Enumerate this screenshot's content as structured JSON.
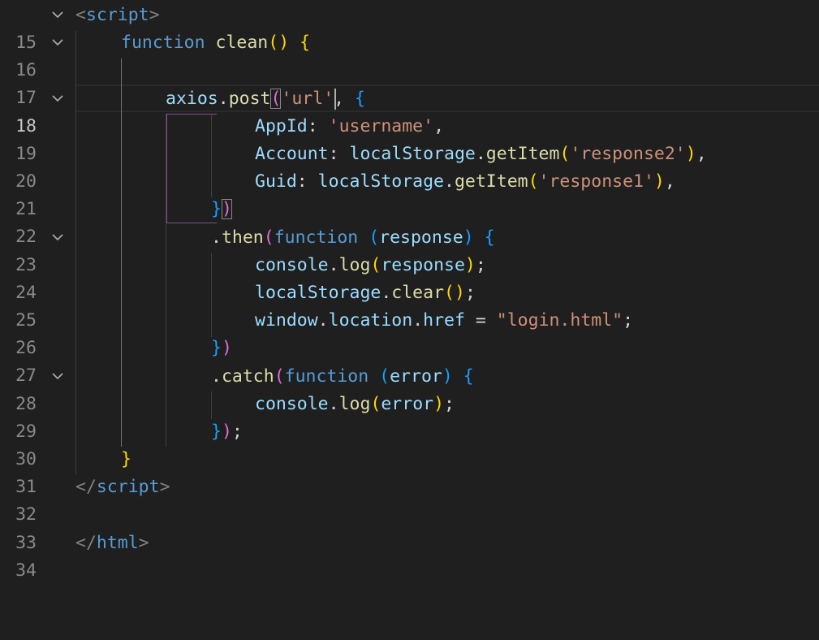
{
  "editor": {
    "lines": [
      {
        "num": "15",
        "fold": true
      },
      {
        "num": "16",
        "fold": true
      },
      {
        "num": "17",
        "fold": false
      },
      {
        "num": "18",
        "fold": true,
        "current": true
      },
      {
        "num": "19",
        "fold": false
      },
      {
        "num": "20",
        "fold": false
      },
      {
        "num": "21",
        "fold": false
      },
      {
        "num": "22",
        "fold": false
      },
      {
        "num": "23",
        "fold": true
      },
      {
        "num": "24",
        "fold": false
      },
      {
        "num": "25",
        "fold": false
      },
      {
        "num": "26",
        "fold": false
      },
      {
        "num": "27",
        "fold": false
      },
      {
        "num": "28",
        "fold": true
      },
      {
        "num": "29",
        "fold": false
      },
      {
        "num": "30",
        "fold": false
      },
      {
        "num": "31",
        "fold": false
      },
      {
        "num": "32",
        "fold": false
      },
      {
        "num": "33",
        "fold": false
      },
      {
        "num": "34",
        "fold": false
      }
    ],
    "tokens": {
      "l15": [
        "<",
        "script",
        ">"
      ],
      "l16": [
        "function",
        "clean",
        "(",
        ")",
        "{"
      ],
      "l18": [
        "axios",
        ".",
        "post",
        "(",
        "'url'",
        ", ",
        "{"
      ],
      "l19": [
        "AppId",
        ": ",
        "'username'",
        ","
      ],
      "l20": [
        "Account",
        ": ",
        "localStorage",
        ".",
        "getItem",
        "(",
        "'response2'",
        ")",
        ","
      ],
      "l21": [
        "Guid",
        ": ",
        "localStorage",
        ".",
        "getItem",
        "(",
        "'response1'",
        ")",
        ","
      ],
      "l22": [
        "}",
        ")"
      ],
      "l23": [
        ".",
        "then",
        "(",
        "function",
        " ",
        "(",
        "response",
        ")",
        " ",
        "{"
      ],
      "l24": [
        "console",
        ".",
        "log",
        "(",
        "response",
        ")",
        ";"
      ],
      "l25": [
        "localStorage",
        ".",
        "clear",
        "(",
        ")",
        ";"
      ],
      "l26": [
        "window",
        ".",
        "location",
        ".",
        "href",
        " = ",
        "\"login.html\"",
        ";"
      ],
      "l27": [
        "}",
        ")"
      ],
      "l28": [
        ".",
        "catch",
        "(",
        "function",
        " ",
        "(",
        "error",
        ")",
        " ",
        "{"
      ],
      "l29": [
        "console",
        ".",
        "log",
        "(",
        "error",
        ")",
        ";"
      ],
      "l30": [
        "}",
        ")",
        ";"
      ],
      "l31": [
        "}"
      ],
      "l32": [
        "</",
        "script",
        ">"
      ],
      "l34": [
        "</",
        "html",
        ">"
      ]
    }
  },
  "icons": {
    "fold": "chevron-down-icon"
  },
  "colors": {
    "background": "#1f1f1f",
    "keyword": "#569cd6",
    "function": "#dcdcaa",
    "variable": "#9cdcfe",
    "string": "#ce9178",
    "bracket_gold": "#ffd700",
    "bracket_purple": "#da70d6",
    "bracket_blue": "#179fff"
  }
}
